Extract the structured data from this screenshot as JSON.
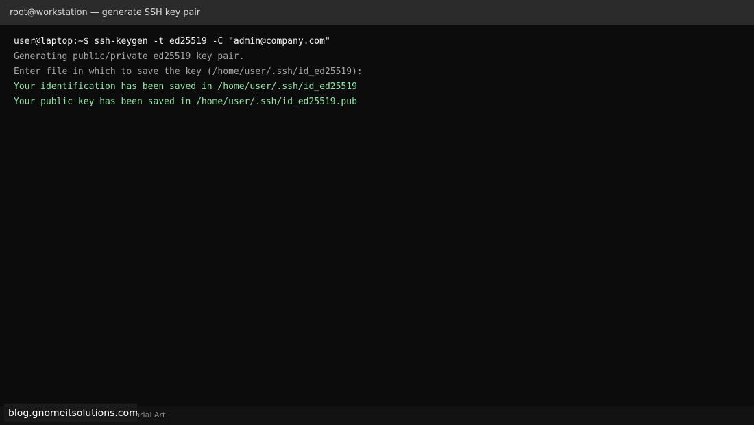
{
  "window": {
    "title": "root@workstation — generate SSH key pair"
  },
  "terminal": {
    "lines": [
      {
        "kind": "cmd",
        "text": "user@laptop:~$ ssh-keygen -t ed25519 -C \"admin@company.com\""
      },
      {
        "kind": "info",
        "text": "Generating public/private ed25519 key pair."
      },
      {
        "kind": "info",
        "text": "Enter file in which to save the key (/home/user/.ssh/id_ed25519):"
      },
      {
        "kind": "success",
        "text": "Your identification has been saved in /home/user/.ssh/id_ed25519"
      },
      {
        "kind": "success",
        "text": "Your public key has been saved in /home/user/.ssh/id_ed25519.pub"
      }
    ]
  },
  "footer": {
    "caption": "utorial Art",
    "watermark": "blog.gnomeitsolutions.com"
  },
  "colors": {
    "background": "#0c0c0c",
    "titlebar": "#2b2b2b",
    "command": "#f2f2f2",
    "info": "#a6a6a6",
    "success": "#8ee6a6"
  }
}
